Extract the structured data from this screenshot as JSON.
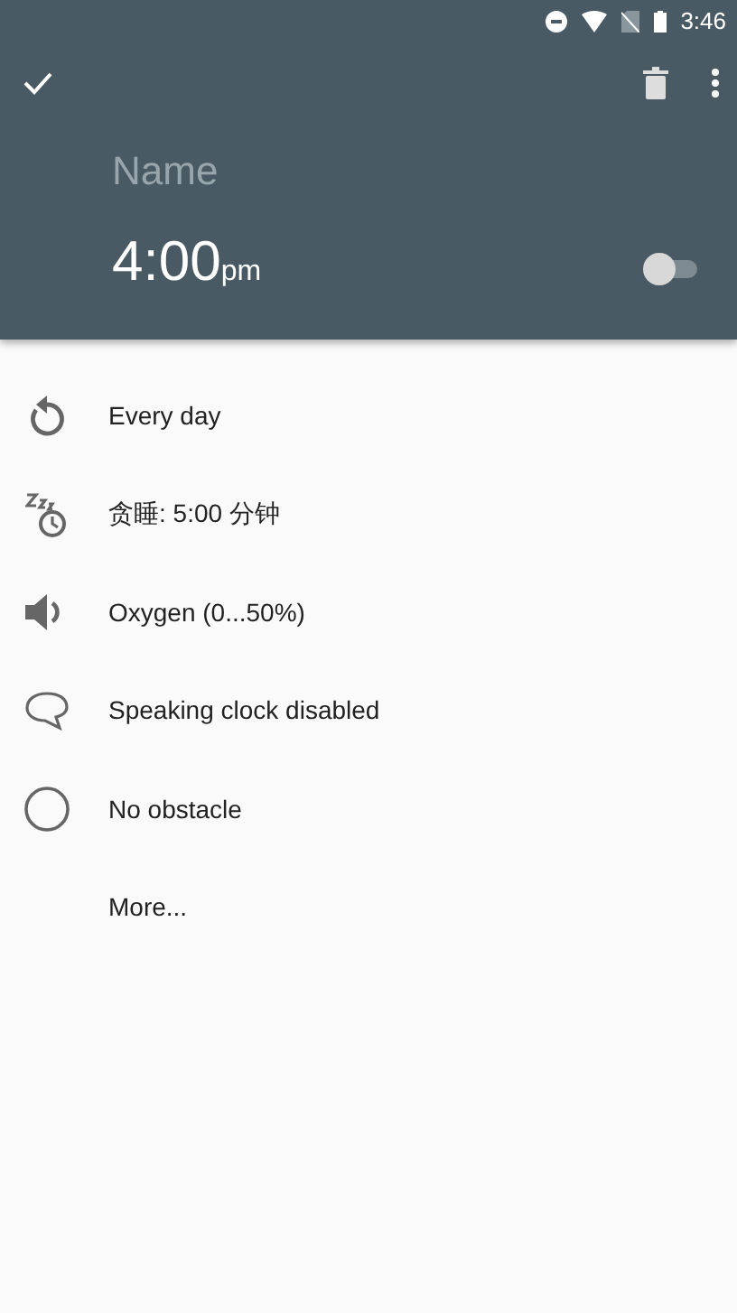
{
  "status_bar": {
    "time": "3:46"
  },
  "alarm": {
    "name_placeholder": "Name",
    "time": "4:00",
    "ampm": "pm",
    "on": false
  },
  "options": [
    {
      "kind": "repeat",
      "label": "Every day"
    },
    {
      "kind": "snooze",
      "label": "贪睡: 5:00 分钟"
    },
    {
      "kind": "sound",
      "label": "Oxygen (0...50%)"
    },
    {
      "kind": "speech",
      "label": "Speaking clock disabled"
    },
    {
      "kind": "obstacle",
      "label": "No obstacle"
    },
    {
      "kind": "more",
      "label": "More..."
    }
  ]
}
